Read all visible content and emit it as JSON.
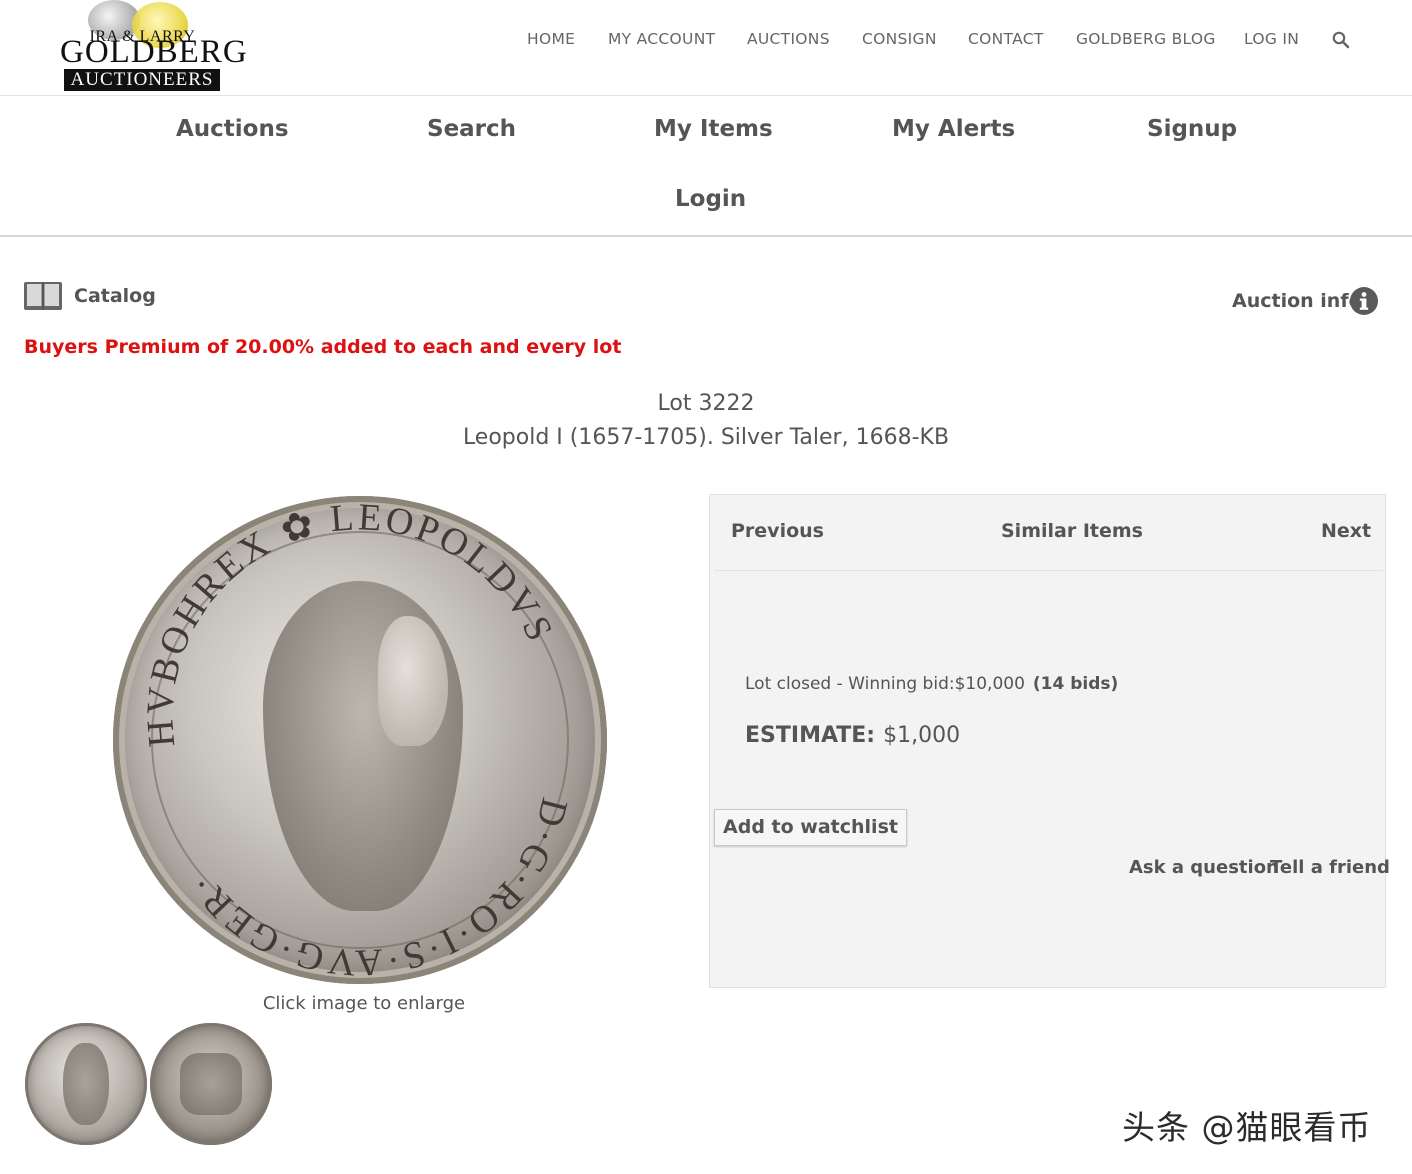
{
  "brand": {
    "logo_line1": "IRA & LARRY",
    "logo_line2": "GOLDBERG",
    "logo_line3": "AUCTIONEERS"
  },
  "top_nav": [
    "HOME",
    "MY ACCOUNT",
    "AUCTIONS",
    "CONSIGN",
    "CONTACT",
    "GOLDBERG BLOG",
    "LOG IN"
  ],
  "sub_nav": [
    "Auctions",
    "Search",
    "My Items",
    "My Alerts",
    "Signup",
    "Login"
  ],
  "catalog": {
    "label": "Catalog",
    "auction_info": "Auction info",
    "premium_notice": "Buyers Premium of 20.00% added to each and every lot"
  },
  "lot": {
    "number": "Lot 3222",
    "title": "Leopold I (1657-1705). Silver Taler, 1668-KB",
    "image_caption": "Click image to enlarge",
    "coin_legend_top": "HVBOHREX ✿ LEOPOLDVS",
    "coin_legend_bottom": "D·G·RO·I·S·AVG·GER·"
  },
  "panel": {
    "prev": "Previous",
    "similar": "Similar Items",
    "next": "Next",
    "status": "Lot closed - Winning bid:$10,000",
    "bids": "(14 bids)",
    "estimate_label": "ESTIMATE:",
    "estimate_value": "$1,000",
    "watchlist": "Add to watchlist",
    "ask": "Ask a question",
    "tell": "Tell a friend"
  },
  "watermark": "头条 @猫眼看币",
  "colors": {
    "premium_red": "#dd1111",
    "panel_bg": "#f3f3f3",
    "text": "#555555"
  }
}
